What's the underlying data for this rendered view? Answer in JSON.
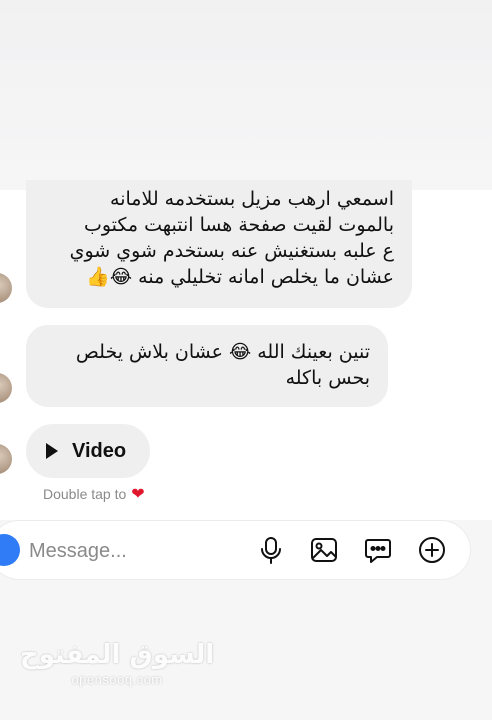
{
  "messages": [
    {
      "lines": [
        "اسمعي ارهب مزيل بستخدمه للامانه",
        "بالموت لقيت صفحة هسا انتبهت مكتوب",
        "ع علبه بستغنيش عنه بستخدم شوي شوي",
        "عشان ما يخلص امانه تخليلي منه 😂👍"
      ]
    },
    {
      "lines": [
        "تنين بعينك الله 😂 عشان بلاش يخلص",
        "بحس باكله"
      ]
    }
  ],
  "video": {
    "label": "Video"
  },
  "reaction_hint": {
    "text": "Double tap to",
    "icon": "heart-icon"
  },
  "composer": {
    "placeholder": "Message...",
    "icons": [
      "microphone-icon",
      "image-icon",
      "sticker-chat-icon",
      "add-icon"
    ],
    "accent": "#2f7cf6"
  },
  "watermark": {
    "arabic": "السوق المفتوح",
    "latin": "opensooq.com"
  }
}
